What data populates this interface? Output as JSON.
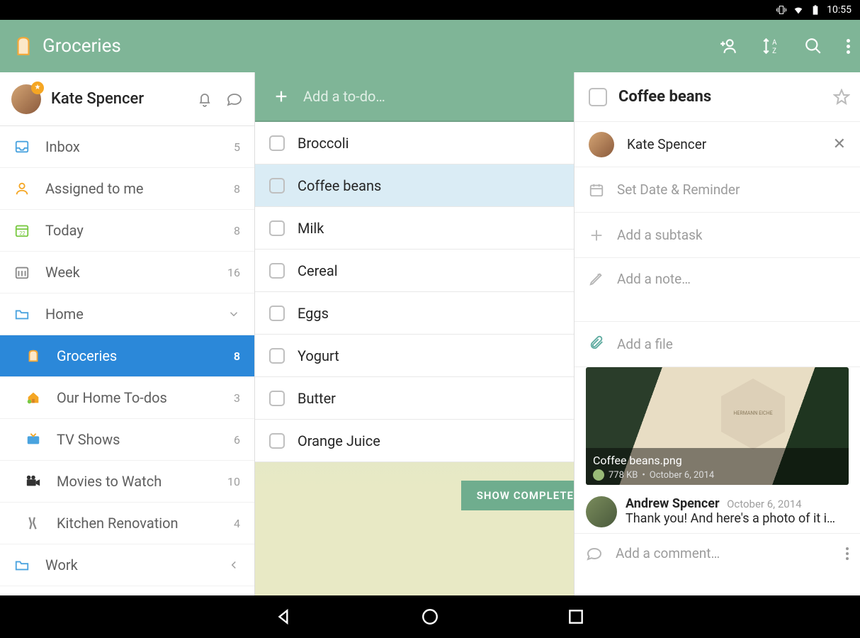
{
  "status": {
    "time": "10:55"
  },
  "toolbar": {
    "title": "Groceries",
    "actions": [
      "add-person",
      "sort-az",
      "search",
      "more"
    ]
  },
  "user": {
    "name": "Kate Spencer"
  },
  "sidebar": {
    "items": [
      {
        "key": "inbox",
        "label": "Inbox",
        "count": "5",
        "icon": "tray"
      },
      {
        "key": "assigned",
        "label": "Assigned to me",
        "count": "8",
        "icon": "user"
      },
      {
        "key": "today",
        "label": "Today",
        "count": "8",
        "icon": "calendar-day"
      },
      {
        "key": "week",
        "label": "Week",
        "count": "16",
        "icon": "calendar-week"
      },
      {
        "key": "home",
        "label": "Home",
        "count": "",
        "icon": "folder",
        "collapsible": true
      },
      {
        "key": "groceries",
        "label": "Groceries",
        "count": "8",
        "icon": "bread",
        "active": true,
        "sub": true
      },
      {
        "key": "hometodos",
        "label": "Our Home To-dos",
        "count": "3",
        "icon": "house",
        "sub": true
      },
      {
        "key": "tv",
        "label": "TV Shows",
        "count": "6",
        "icon": "tv",
        "sub": true
      },
      {
        "key": "movies",
        "label": "Movies to Watch",
        "count": "10",
        "icon": "camera",
        "sub": true
      },
      {
        "key": "kitchen",
        "label": "Kitchen Renovation",
        "count": "4",
        "icon": "tools",
        "sub": true
      },
      {
        "key": "work",
        "label": "Work",
        "count": "",
        "icon": "folder",
        "collapsible": true
      }
    ]
  },
  "middle": {
    "add_placeholder": "Add a to-do…",
    "tasks": [
      {
        "label": "Broccoli"
      },
      {
        "label": "Coffee beans",
        "selected": true
      },
      {
        "label": "Milk"
      },
      {
        "label": "Cereal"
      },
      {
        "label": "Eggs"
      },
      {
        "label": "Yogurt"
      },
      {
        "label": "Butter"
      },
      {
        "label": "Orange Juice"
      }
    ],
    "show_completed_label": "SHOW COMPLETE"
  },
  "detail": {
    "title": "Coffee beans",
    "assignee": "Kate Spencer",
    "reminder_placeholder": "Set Date & Reminder",
    "subtask_placeholder": "Add a subtask",
    "note_placeholder": "Add a note…",
    "file_placeholder": "Add a file",
    "attachment": {
      "filename": "Coffee beans.png",
      "label_text": "HERMANN EICHE",
      "size": "778 KB",
      "date": "October 6, 2014"
    },
    "comment": {
      "author": "Andrew Spencer",
      "date": "October 6, 2014",
      "text": "Thank you! And here's a photo of it i…"
    },
    "comment_placeholder": "Add a comment…"
  }
}
